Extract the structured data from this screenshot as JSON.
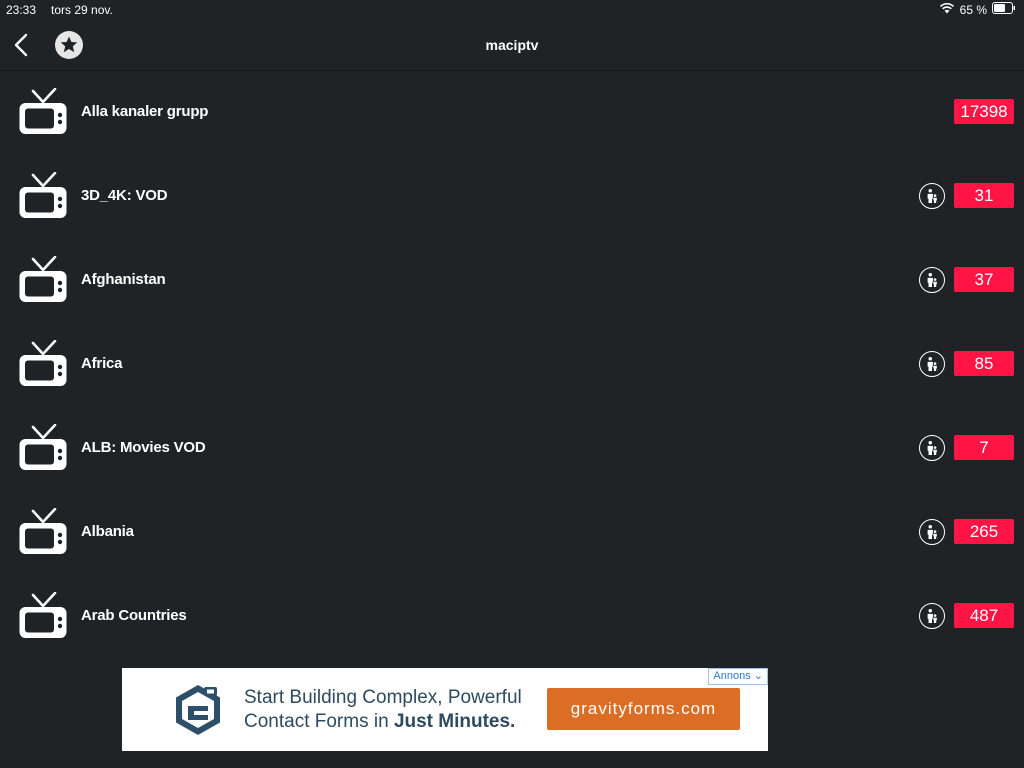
{
  "status_bar": {
    "time": "23:33",
    "date": "tors 29 nov.",
    "battery": "65 %"
  },
  "nav": {
    "title": "maciptv"
  },
  "groups": [
    {
      "label": "Alla kanaler grupp",
      "count": "17398",
      "has_parental": false
    },
    {
      "label": "3D_4K: VOD",
      "count": "31",
      "has_parental": true
    },
    {
      "label": "Afghanistan",
      "count": "37",
      "has_parental": true
    },
    {
      "label": "Africa",
      "count": "85",
      "has_parental": true
    },
    {
      "label": "ALB: Movies VOD",
      "count": "7",
      "has_parental": true
    },
    {
      "label": "Albania",
      "count": "265",
      "has_parental": true
    },
    {
      "label": "Arab Countries",
      "count": "487",
      "has_parental": true
    }
  ],
  "ad": {
    "tag": "Annons",
    "line1": "Start Building Complex, Powerful",
    "line2_prefix": "Contact Forms in",
    "line2_bold": "Just Minutes.",
    "cta": "gravityforms.com"
  },
  "colors": {
    "background": "#1f2326",
    "badge": "#ff1446",
    "ad_cta": "#dc6d24"
  }
}
